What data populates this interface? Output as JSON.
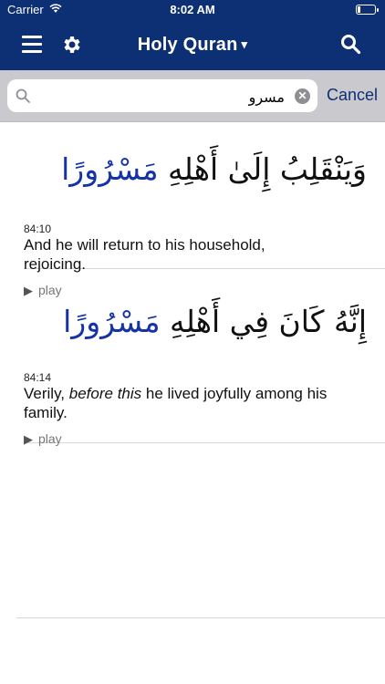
{
  "status": {
    "carrier": "Carrier",
    "time": "8:02 AM"
  },
  "nav": {
    "title": "Holy Quran",
    "caret": "▾"
  },
  "search": {
    "value": "مسرو",
    "placeholder": "",
    "cancel_label": "Cancel",
    "clear_glyph": "✕"
  },
  "results": [
    {
      "arabic_prefix": "وَيَنْقَلِبُ إِلَىٰ أَهْلِهِ ",
      "arabic_highlight": "مَسْرُورًا",
      "ref": "84:10",
      "text_plain": "And he will return to his household, rejoicing.",
      "play_label": "play"
    },
    {
      "arabic_prefix": "إِنَّهُ كَانَ فِي أَهْلِهِ ",
      "arabic_highlight": "مَسْرُورًا",
      "ref": "84:14",
      "text_start": "Verily, ",
      "text_italic": "before this",
      "text_end": " he lived joyfully among his family.",
      "play_label": "play"
    }
  ],
  "colors": {
    "nav_bg": "#0d2f73",
    "highlight": "#1633a6",
    "search_bar_bg": "#c9c9ce"
  },
  "icons": [
    "wifi-icon",
    "battery-icon",
    "menu-icon",
    "gear-icon",
    "search-icon",
    "clear-icon",
    "play-icon"
  ]
}
